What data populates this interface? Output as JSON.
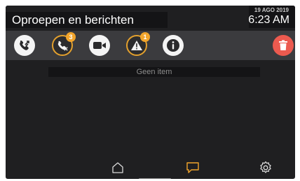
{
  "header": {
    "title": "Oproepen en berichten",
    "date": "19 AGO 2019",
    "time": "6:23 AM"
  },
  "toolbar": {
    "buttons": [
      {
        "name": "calls",
        "icon": "phone-arrows-icon"
      },
      {
        "name": "missed-calls",
        "icon": "phone-missed-icon",
        "badge": "3"
      },
      {
        "name": "video-messages",
        "icon": "video-camera-icon"
      },
      {
        "name": "alarms",
        "icon": "warning-triangle-icon",
        "badge": "1"
      },
      {
        "name": "info",
        "icon": "info-icon"
      },
      {
        "name": "delete",
        "icon": "trash-icon"
      }
    ]
  },
  "content": {
    "empty_text": "Geen item"
  },
  "nav": {
    "items": [
      {
        "name": "home",
        "icon": "home-icon"
      },
      {
        "name": "messages",
        "icon": "chat-bubble-icon",
        "active": true
      },
      {
        "name": "settings",
        "icon": "gear-icon"
      }
    ]
  },
  "colors": {
    "background": "#1f1f21",
    "toolbar": "#3b3b3e",
    "accent": "#f2a52c",
    "delete": "#ec5a4f"
  }
}
